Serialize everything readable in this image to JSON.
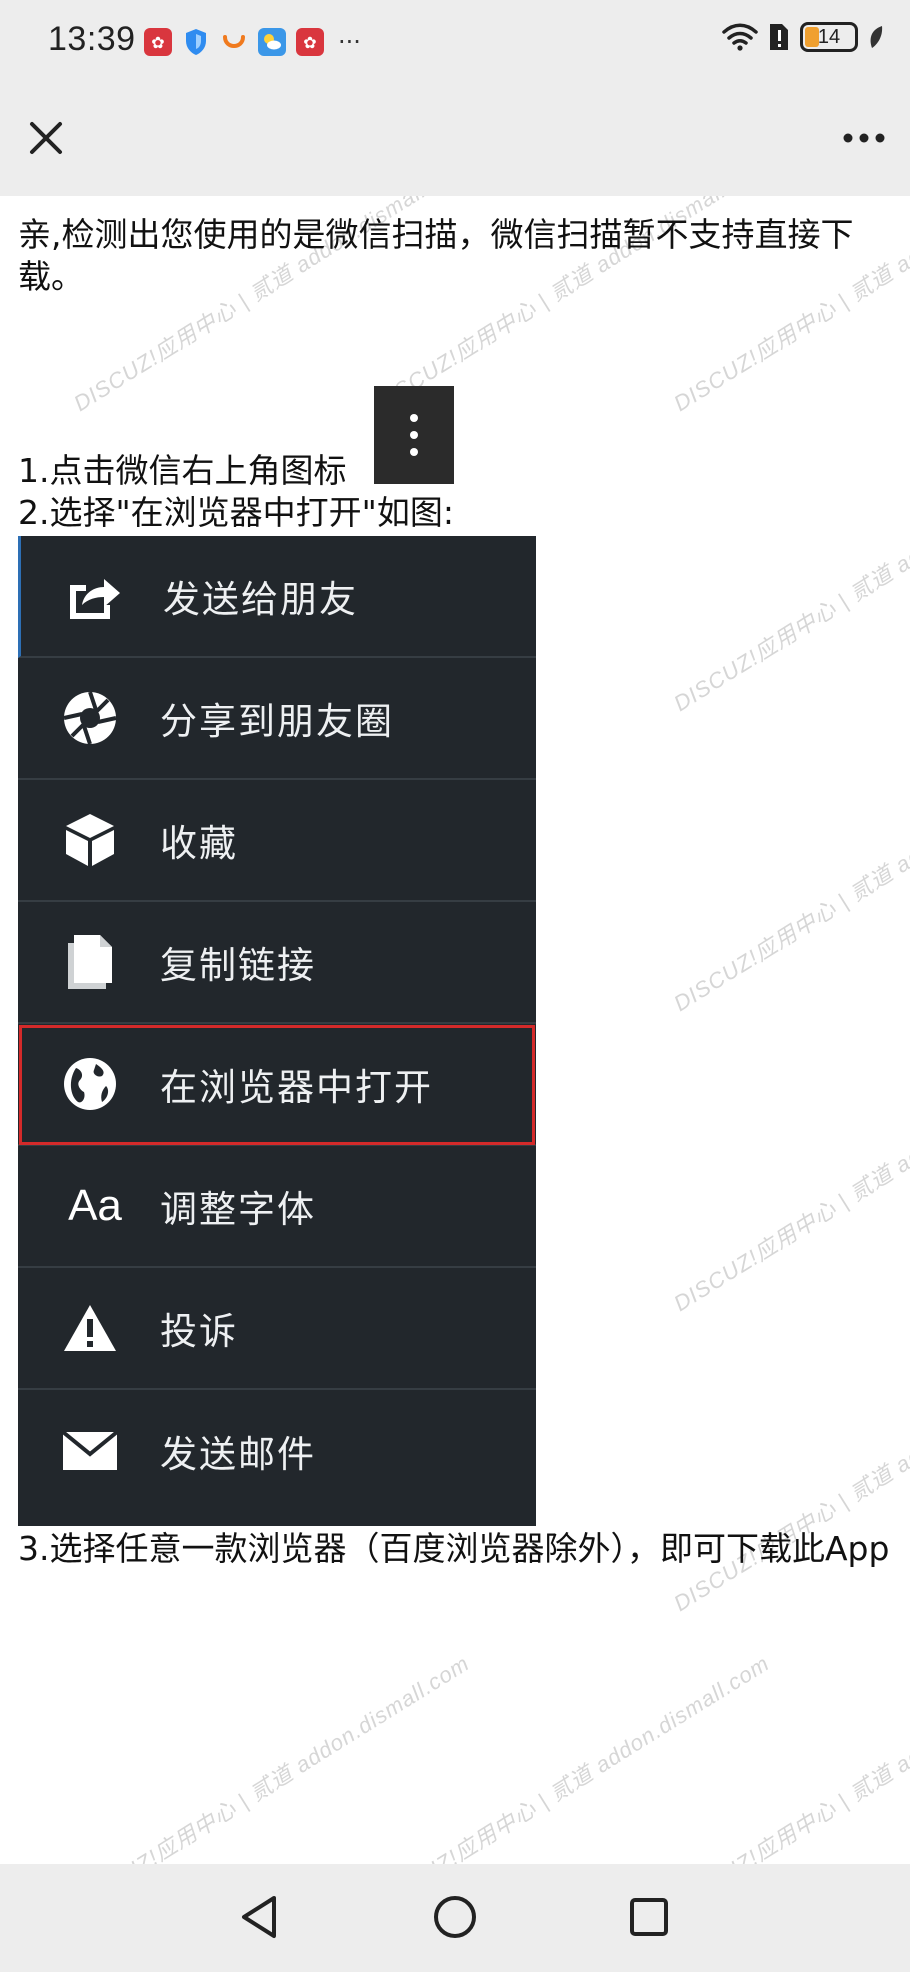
{
  "status_bar": {
    "time": "13:39",
    "notification_icons": [
      "huawei-app-icon",
      "shield-icon",
      "app-icon-orange",
      "weather-icon",
      "huawei-app-icon"
    ],
    "more_label": "···",
    "battery": "14",
    "battery_color": "#f0a030"
  },
  "title_bar": {
    "close_icon": "close-icon",
    "more_icon": "more-dots-icon"
  },
  "content": {
    "intro": "亲,检测出您使用的是微信扫描，微信扫描暂不支持直接下载。",
    "step1": "1.点击微信右上角图标",
    "step2": "2.选择\"在浏览器中打开\"如图:",
    "step3": "3.选择任意一款浏览器（百度浏览器除外），即可下载此App",
    "watermark": "DISCUZ!应用中心 | 贰道 addon.dismall.com"
  },
  "menu": {
    "items": [
      {
        "icon": "share-icon",
        "label": "发送给朋友"
      },
      {
        "icon": "moments-icon",
        "label": "分享到朋友圈"
      },
      {
        "icon": "cube-icon",
        "label": "收藏"
      },
      {
        "icon": "copy-icon",
        "label": "复制链接"
      },
      {
        "icon": "globe-icon",
        "label": "在浏览器中打开"
      },
      {
        "icon": "font-icon",
        "label": "调整字体"
      },
      {
        "icon": "warning-icon",
        "label": "投诉"
      },
      {
        "icon": "mail-icon",
        "label": "发送邮件"
      }
    ],
    "font_icon_text": "Aa",
    "highlight_color": "#d42a2a"
  },
  "nav_bar": {
    "back_icon": "back-triangle-icon",
    "home_icon": "home-circle-icon",
    "recent_icon": "recent-square-icon"
  }
}
